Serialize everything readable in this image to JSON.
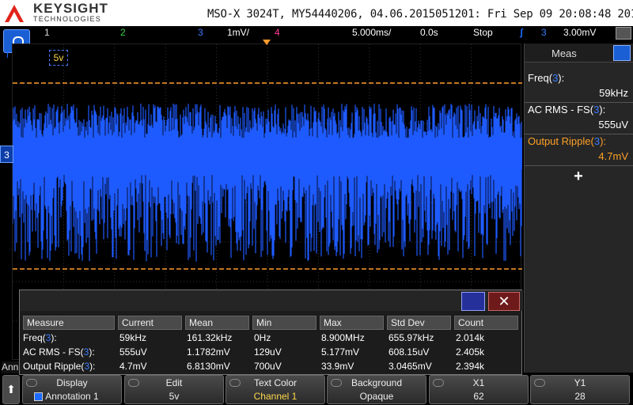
{
  "header": {
    "brand": "KEYSIGHT",
    "brand_sub": "TECHNOLOGIES",
    "info": "MSO-X 3024T, MY54440206, 04.06.2015051201: Fri Sep 09 20:08:48 2016"
  },
  "status": {
    "ch1": "1",
    "ch2": "2",
    "ch3": "3",
    "scale": "1mV/",
    "ch4": "4",
    "timebase": "5.000ms/",
    "delay": "0.0s",
    "run": "Stop",
    "trig_ch": "3",
    "trig_level": "3.00mV"
  },
  "scope": {
    "annotation": "5v",
    "ground_marker": "3",
    "left_t": "T",
    "colors": {
      "trace": "#1e5bff",
      "cursor": "#ff9a2a"
    }
  },
  "meas_panel": {
    "title": "Meas",
    "add": "+",
    "items": [
      {
        "name": "Freq(",
        "ch": "3",
        "close": "):",
        "value": "59kHz",
        "highlight": false
      },
      {
        "name": "AC RMS - FS(",
        "ch": "3",
        "close": "):",
        "value": "555uV",
        "highlight": false
      },
      {
        "name": "Output Ripple(",
        "ch": "3",
        "close": "):",
        "value": "4.7mV",
        "highlight": true
      }
    ]
  },
  "stats": {
    "headers": [
      "Measure",
      "Current",
      "Mean",
      "Min",
      "Max",
      "Std Dev",
      "Count"
    ],
    "rows": [
      {
        "measure": "Freq(",
        "ch": "3",
        "close": "):",
        "current": "59kHz",
        "mean": "161.32kHz",
        "min": "0Hz",
        "max": "8.900MHz",
        "std": "655.97kHz",
        "count": "2.014k"
      },
      {
        "measure": "AC RMS - FS(",
        "ch": "3",
        "close": "):",
        "current": "555uV",
        "mean": "1.1782mV",
        "min": "129uV",
        "max": "5.177mV",
        "std": "608.15uV",
        "count": "2.405k"
      },
      {
        "measure": "Output Ripple(",
        "ch": "3",
        "close": "):",
        "current": "4.7mV",
        "mean": "6.8130mV",
        "min": "700uV",
        "max": "33.9mV",
        "std": "3.0465mV",
        "count": "2.394k"
      }
    ],
    "close": "✕"
  },
  "ann_stub": "Ann",
  "softkeys": [
    {
      "label": "Display",
      "value": "Annotation 1"
    },
    {
      "label": "Edit",
      "value": "5v"
    },
    {
      "label": "Text Color",
      "value": "Channel 1"
    },
    {
      "label": "Background",
      "value": "Opaque"
    },
    {
      "label": "X1",
      "value": "62"
    },
    {
      "label": "Y1",
      "value": "28"
    }
  ]
}
